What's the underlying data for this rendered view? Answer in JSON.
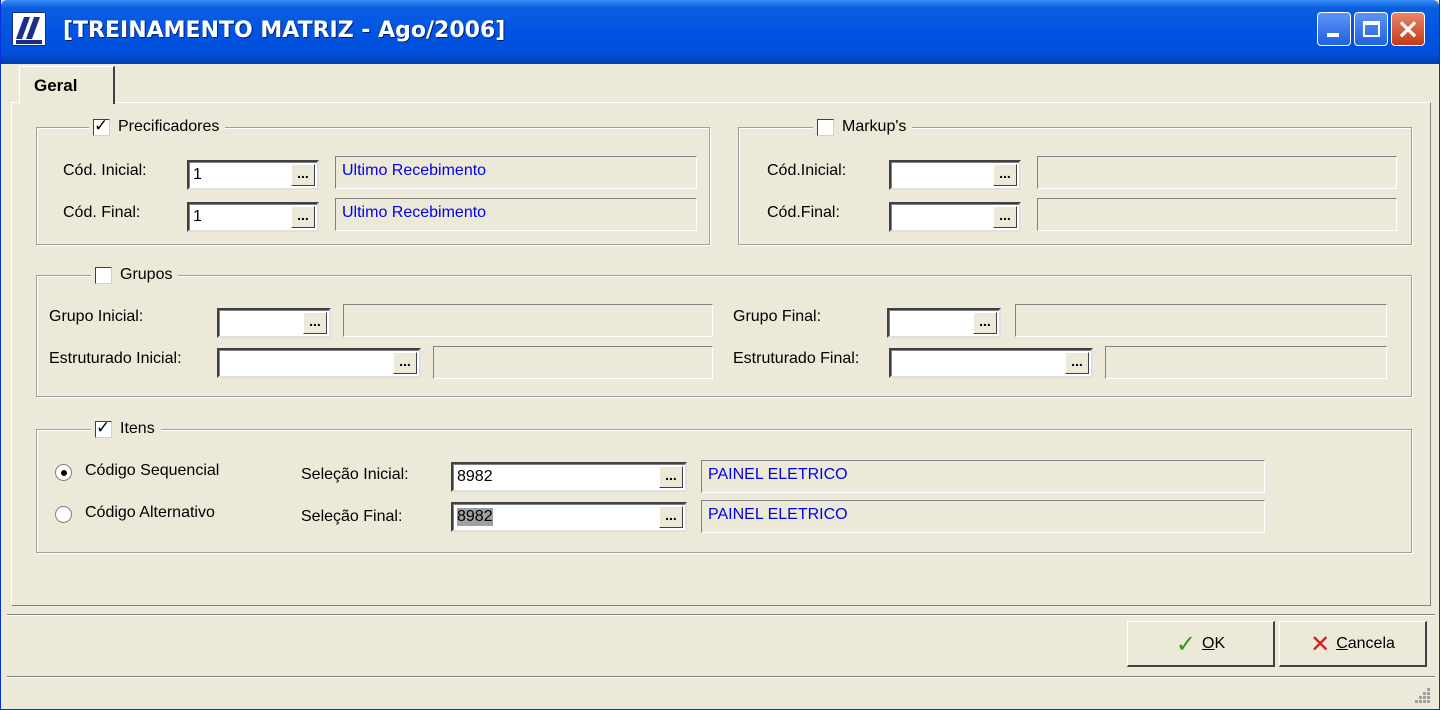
{
  "window": {
    "title": "[TREINAMENTO MATRIZ - Ago/2006]"
  },
  "tabs": [
    {
      "label": "Geral"
    }
  ],
  "precificadores": {
    "legend": "Precificadores",
    "checked": true,
    "cod_inicial": {
      "label": "Cód. Inicial:",
      "value": "1",
      "description": "Ultimo Recebimento"
    },
    "cod_final": {
      "label": "Cód. Final:",
      "value": "1",
      "description": "Ultimo Recebimento"
    }
  },
  "markups": {
    "legend": "Markup's",
    "checked": false,
    "cod_inicial": {
      "label": "Cód.Inicial:",
      "value": "",
      "description": ""
    },
    "cod_final": {
      "label": "Cód.Final:",
      "value": "",
      "description": ""
    }
  },
  "grupos": {
    "legend": "Grupos",
    "checked": false,
    "grupo_inicial": {
      "label": "Grupo Inicial:",
      "value": "",
      "description": ""
    },
    "grupo_final": {
      "label": "Grupo Final:",
      "value": "",
      "description": ""
    },
    "estruturado_inicial": {
      "label": "Estruturado Inicial:",
      "value": "",
      "description": ""
    },
    "estruturado_final": {
      "label": "Estruturado Final:",
      "value": "",
      "description": ""
    }
  },
  "itens": {
    "legend": "Itens",
    "checked": true,
    "radio_sequencial": {
      "label": "Código Sequencial",
      "selected": true
    },
    "radio_alternativo": {
      "label": "Código Alternativo",
      "selected": false
    },
    "selecao_inicial": {
      "label": "Seleção Inicial:",
      "value": "8982",
      "description": "PAINEL ELETRICO"
    },
    "selecao_final": {
      "label": "Seleção Final:",
      "value": "8982",
      "description": "PAINEL ELETRICO"
    }
  },
  "buttons": {
    "ok": {
      "accel": "O",
      "rest": "K"
    },
    "cancela": {
      "accel": "C",
      "rest": "ancela"
    }
  },
  "ellipsis": "...",
  "checkmark": "✓",
  "colors": {
    "titlebar": "#0054e3",
    "description_text": "#0000ee",
    "ok_icon": "#2e9a1a",
    "cancel_icon": "#d02020"
  }
}
